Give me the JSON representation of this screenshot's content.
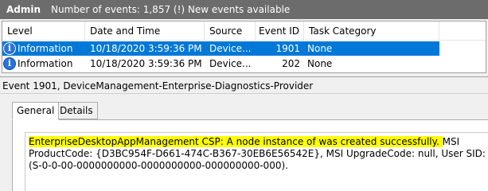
{
  "titlebar": {
    "log_name": "Admin",
    "count_text": "Number of events: 1,857 (!) New events available"
  },
  "columns": {
    "level": "Level",
    "datetime": "Date and Time",
    "source": "Source",
    "event_id": "Event ID",
    "task_category": "Task Category"
  },
  "events": [
    {
      "icon": "information-icon",
      "level": "Information",
      "datetime": "10/18/2020 3:59:36 PM",
      "source": "Device...",
      "event_id": "1901",
      "task_category": "None",
      "selected": true
    },
    {
      "icon": "information-icon",
      "level": "Information",
      "datetime": "10/18/2020 3:59:36 PM",
      "source": "Device...",
      "event_id": "202",
      "task_category": "None",
      "selected": false
    }
  ],
  "detail": {
    "header": "Event 1901, DeviceManagement-Enterprise-Diagnostics-Provider",
    "tabs": [
      "General",
      "Details"
    ],
    "active_tab": "General",
    "description_highlighted": "EnterpriseDesktopAppManagement CSP: A node instance of was created successfully. ",
    "description_rest": " MSI ProductCode: {D3BC954F-D661-474C-B367-30EB6E56542E}, MSI UpgradeCode: null, User SID: (S-0-0-00-0000000000-0000000000-000000000-000)."
  },
  "colors": {
    "titlebar_bg": "#6c6c6c",
    "selection_bg": "#0078d7",
    "highlight": "#ffff00",
    "info_icon": "#2a73d9"
  }
}
